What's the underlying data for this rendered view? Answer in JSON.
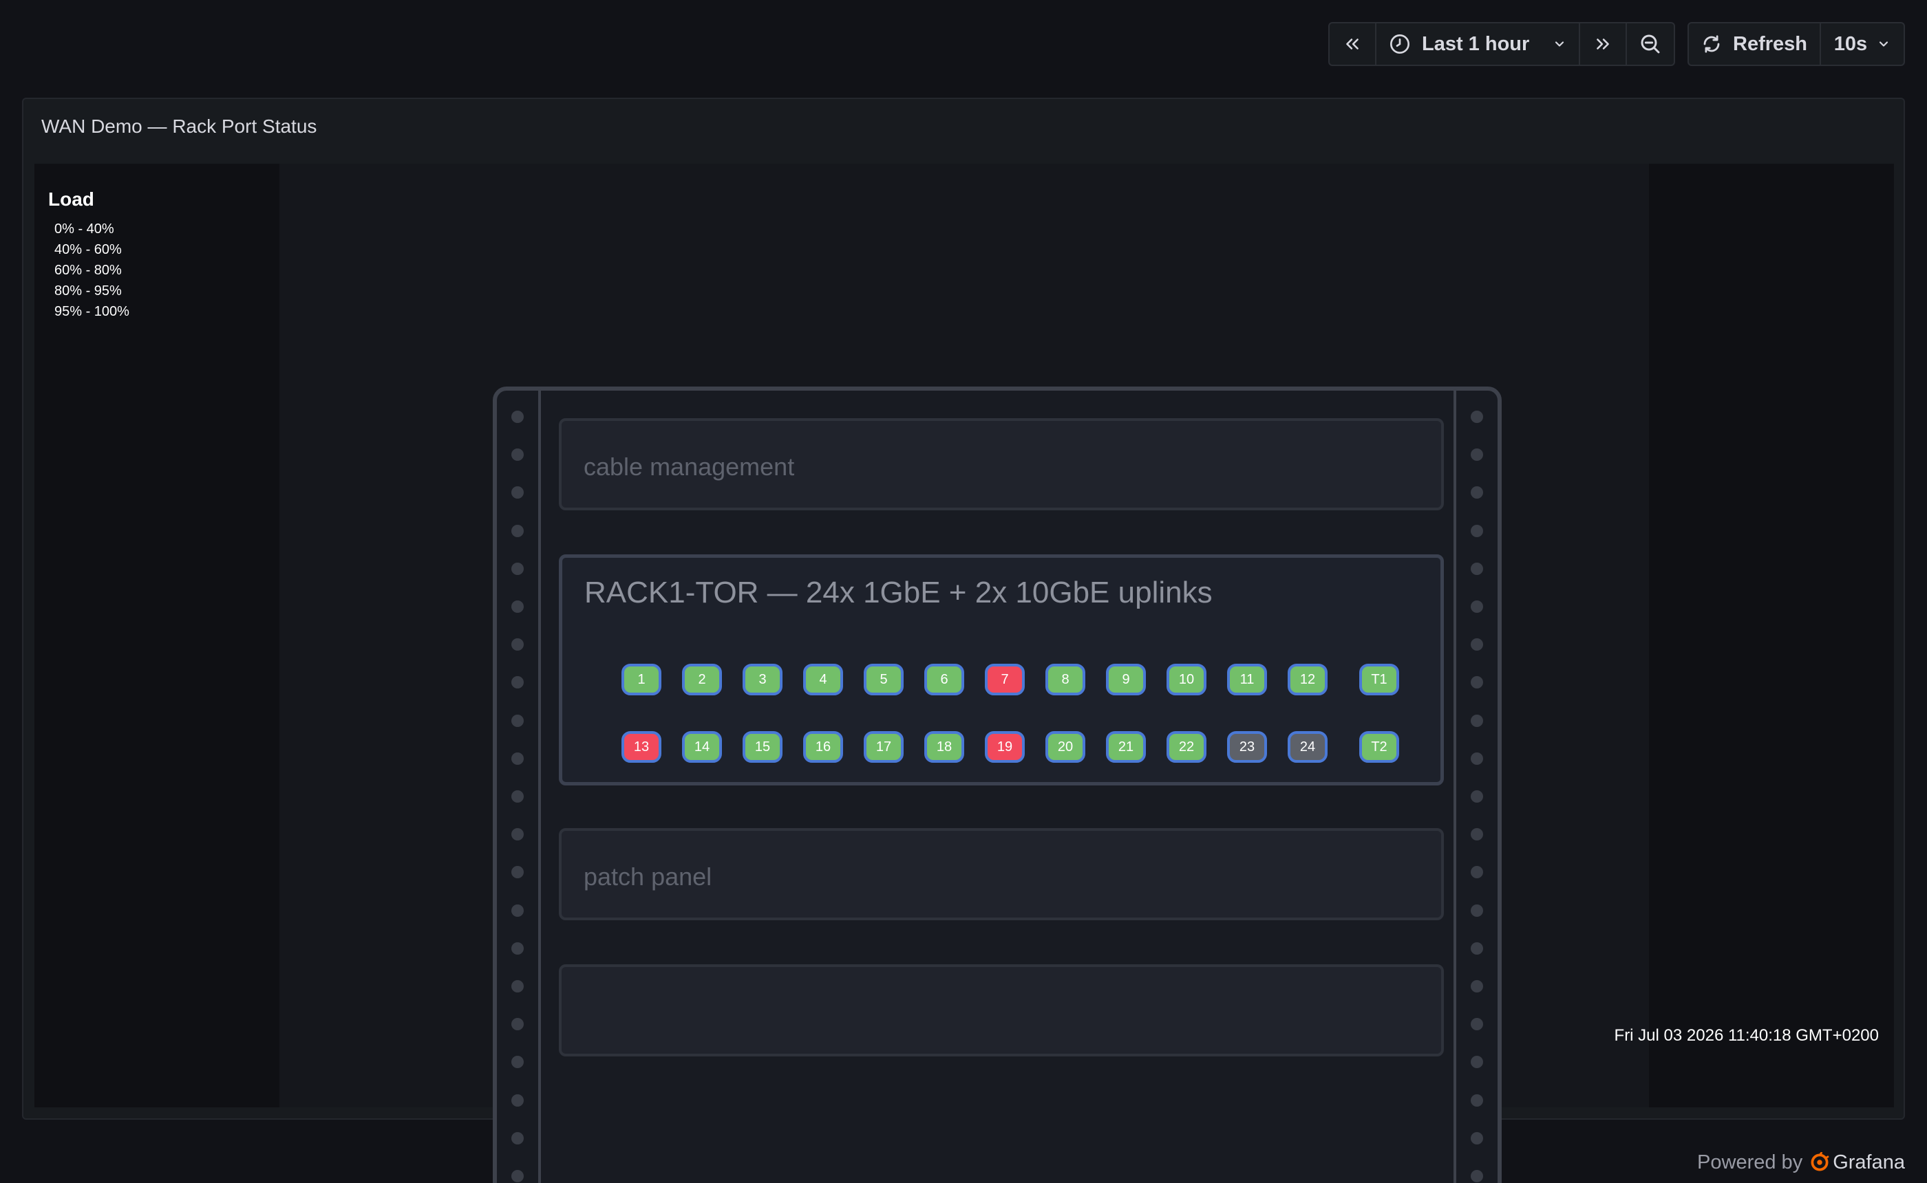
{
  "toolbar": {
    "time_range": "Last 1 hour",
    "refresh_label": "Refresh",
    "refresh_interval": "10s"
  },
  "panel": {
    "title": "WAN Demo — Rack Port Status"
  },
  "legend": {
    "title": "Load",
    "items": [
      "0% - 40%",
      "40% - 60%",
      "60% - 80%",
      "80% - 95%",
      "95% - 100%"
    ]
  },
  "rack": {
    "units": {
      "cable_management": "cable management",
      "switch": "RACK1-TOR — 24x 1GbE + 2x 10GbE uplinks",
      "patch_panel": "patch panel",
      "empty": ""
    },
    "ports_row1": [
      {
        "label": "1",
        "status": "ok"
      },
      {
        "label": "2",
        "status": "ok"
      },
      {
        "label": "3",
        "status": "ok"
      },
      {
        "label": "4",
        "status": "ok"
      },
      {
        "label": "5",
        "status": "ok"
      },
      {
        "label": "6",
        "status": "ok"
      },
      {
        "label": "7",
        "status": "crit"
      },
      {
        "label": "8",
        "status": "ok"
      },
      {
        "label": "9",
        "status": "ok"
      },
      {
        "label": "10",
        "status": "ok"
      },
      {
        "label": "11",
        "status": "ok"
      },
      {
        "label": "12",
        "status": "ok"
      },
      {
        "label": "T1",
        "status": "ok"
      }
    ],
    "ports_row2": [
      {
        "label": "13",
        "status": "crit"
      },
      {
        "label": "14",
        "status": "ok"
      },
      {
        "label": "15",
        "status": "ok"
      },
      {
        "label": "16",
        "status": "ok"
      },
      {
        "label": "17",
        "status": "ok"
      },
      {
        "label": "18",
        "status": "ok"
      },
      {
        "label": "19",
        "status": "crit"
      },
      {
        "label": "20",
        "status": "ok"
      },
      {
        "label": "21",
        "status": "ok"
      },
      {
        "label": "22",
        "status": "ok"
      },
      {
        "label": "23",
        "status": "off"
      },
      {
        "label": "24",
        "status": "off"
      },
      {
        "label": "T2",
        "status": "ok"
      }
    ]
  },
  "timestamp": "Fri Jul 03 2026 11:40:18 GMT+0200",
  "footer": {
    "powered_by": "Powered by",
    "brand": "Grafana"
  },
  "colors": {
    "ok": "#73bf69",
    "crit": "#f2495c",
    "off": "#5d6169",
    "port_border": "#4a79d6",
    "brand": "#f46800"
  }
}
